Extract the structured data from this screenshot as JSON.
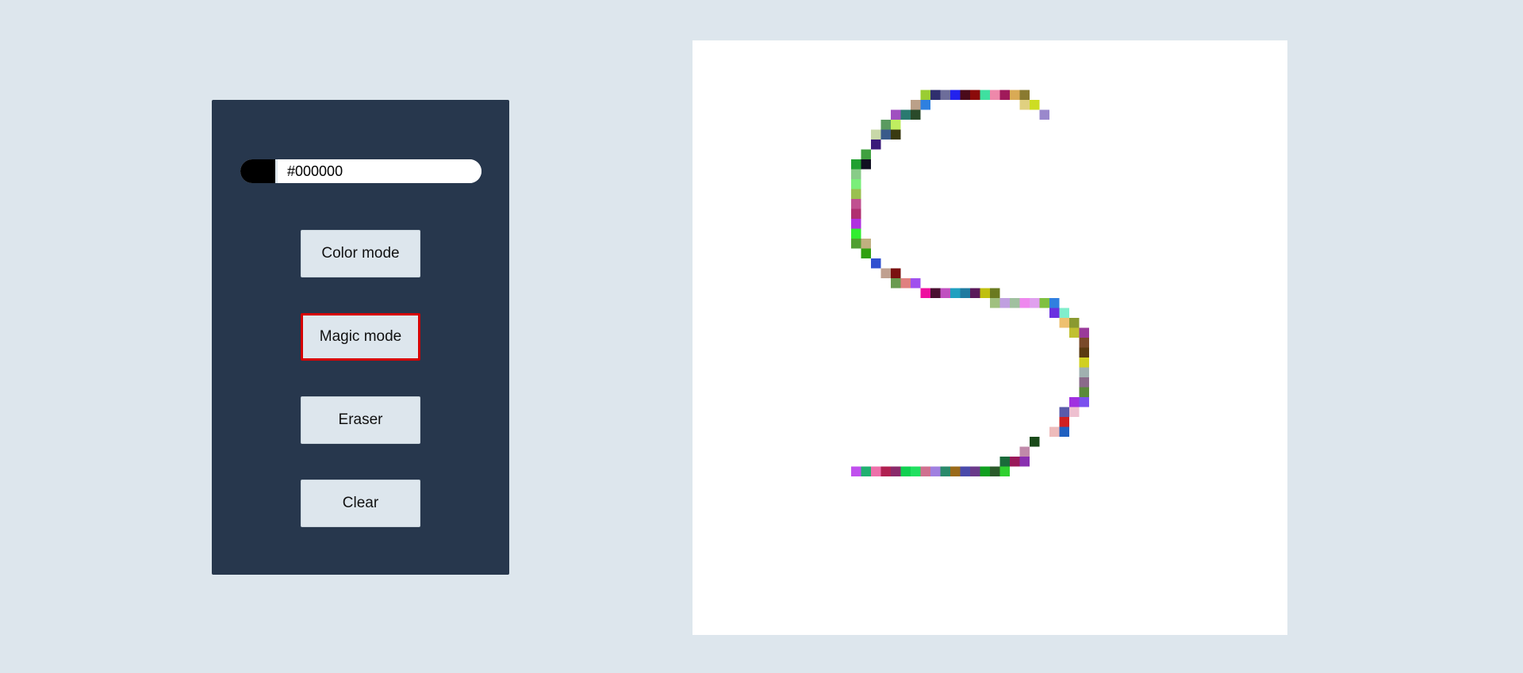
{
  "controls": {
    "swatch_color": "#000000",
    "hex_value": "#000000",
    "color_mode_label": "Color mode",
    "magic_mode_label": "Magic mode",
    "eraser_label": "Eraser",
    "clear_label": "Clear",
    "active_mode": "magic"
  },
  "colors": {
    "background": "#dde6ed",
    "panel": "#27374d",
    "active_border": "#d60000",
    "canvas": "#ffffff"
  },
  "canvas": {
    "cell_size_px": 12.5,
    "drawn_stroke": {
      "shape": "S",
      "cells": [
        [
          23,
          5,
          "#9acd32"
        ],
        [
          24,
          5,
          "#2f2f6e"
        ],
        [
          25,
          5,
          "#6d6d9a"
        ],
        [
          26,
          5,
          "#2222ee"
        ],
        [
          27,
          5,
          "#4a0a1a"
        ],
        [
          28,
          5,
          "#8b0a0a"
        ],
        [
          29,
          5,
          "#3fe0a0"
        ],
        [
          30,
          5,
          "#ee88aa"
        ],
        [
          31,
          5,
          "#a01a5a"
        ],
        [
          32,
          5,
          "#d9aa55"
        ],
        [
          33,
          5,
          "#8a7a30"
        ],
        [
          22,
          6,
          "#bba088"
        ],
        [
          23,
          6,
          "#2e80e0"
        ],
        [
          33,
          6,
          "#e0d080"
        ],
        [
          34,
          6,
          "#cddd22"
        ],
        [
          20,
          7,
          "#a050c0"
        ],
        [
          21,
          7,
          "#2a7a70"
        ],
        [
          22,
          7,
          "#2a4a2a"
        ],
        [
          35,
          7,
          "#9a88cc"
        ],
        [
          19,
          8,
          "#5a9a60"
        ],
        [
          20,
          8,
          "#c0ee60"
        ],
        [
          18,
          9,
          "#c8d8a8"
        ],
        [
          19,
          9,
          "#3a5a8a"
        ],
        [
          20,
          9,
          "#3a3a10"
        ],
        [
          18,
          10,
          "#3a1a7a"
        ],
        [
          17,
          11,
          "#40a040"
        ],
        [
          16,
          12,
          "#20a030"
        ],
        [
          17,
          12,
          "#101020"
        ],
        [
          16,
          13,
          "#88cc88"
        ],
        [
          16,
          14,
          "#7aee7a"
        ],
        [
          16,
          15,
          "#9ac050"
        ],
        [
          16,
          16,
          "#c05090"
        ],
        [
          16,
          17,
          "#b03070"
        ],
        [
          16,
          18,
          "#b030e0"
        ],
        [
          16,
          19,
          "#30ee30"
        ],
        [
          16,
          20,
          "#50a030"
        ],
        [
          17,
          20,
          "#c0b080"
        ],
        [
          17,
          21,
          "#30a010"
        ],
        [
          18,
          22,
          "#3050d0"
        ],
        [
          19,
          23,
          "#c0a090"
        ],
        [
          20,
          23,
          "#7a1010"
        ],
        [
          20,
          24,
          "#6a9a50"
        ],
        [
          21,
          24,
          "#e08080"
        ],
        [
          22,
          24,
          "#a050ee"
        ],
        [
          23,
          25,
          "#ee10a0"
        ],
        [
          24,
          25,
          "#4a1030"
        ],
        [
          25,
          25,
          "#c050c0"
        ],
        [
          26,
          25,
          "#20a0c0"
        ],
        [
          27,
          25,
          "#207aa0"
        ],
        [
          28,
          25,
          "#5a1a5a"
        ],
        [
          29,
          25,
          "#c0c010"
        ],
        [
          30,
          25,
          "#6a7a20"
        ],
        [
          30,
          26,
          "#a0c080"
        ],
        [
          31,
          26,
          "#c0a0e0"
        ],
        [
          32,
          26,
          "#a0c0a0"
        ],
        [
          33,
          26,
          "#ee88ee"
        ],
        [
          34,
          26,
          "#e0a0ee"
        ],
        [
          35,
          26,
          "#80c040"
        ],
        [
          36,
          26,
          "#3080e0"
        ],
        [
          36,
          27,
          "#6a30e0"
        ],
        [
          37,
          27,
          "#80eecc"
        ],
        [
          37,
          28,
          "#eec070"
        ],
        [
          38,
          28,
          "#8a9a30"
        ],
        [
          38,
          29,
          "#c0c030"
        ],
        [
          39,
          29,
          "#9a3a9a"
        ],
        [
          39,
          30,
          "#7a4a2a"
        ],
        [
          39,
          31,
          "#5a3a10"
        ],
        [
          39,
          32,
          "#d0d020"
        ],
        [
          39,
          33,
          "#a0b0b0"
        ],
        [
          39,
          34,
          "#8a6a8a"
        ],
        [
          39,
          35,
          "#5a8a3a"
        ],
        [
          38,
          36,
          "#a030e0"
        ],
        [
          39,
          36,
          "#7a50ee"
        ],
        [
          37,
          37,
          "#5a5aaa"
        ],
        [
          38,
          37,
          "#eec0d0"
        ],
        [
          37,
          38,
          "#d02020"
        ],
        [
          36,
          39,
          "#eebbbb"
        ],
        [
          37,
          39,
          "#2060c0"
        ],
        [
          34,
          40,
          "#1a4a1a"
        ],
        [
          33,
          41,
          "#c08aaa"
        ],
        [
          31,
          42,
          "#1a6a3a"
        ],
        [
          32,
          42,
          "#9a1a5a"
        ],
        [
          33,
          42,
          "#8a30b0"
        ],
        [
          16,
          43,
          "#c050ee"
        ],
        [
          17,
          43,
          "#20b070"
        ],
        [
          18,
          43,
          "#ee70aa"
        ],
        [
          19,
          43,
          "#b02050"
        ],
        [
          20,
          43,
          "#8a2a6a"
        ],
        [
          21,
          43,
          "#10d050"
        ],
        [
          22,
          43,
          "#20e060"
        ],
        [
          23,
          43,
          "#d07090"
        ],
        [
          24,
          43,
          "#a080e0"
        ],
        [
          25,
          43,
          "#2a8a6a"
        ],
        [
          26,
          43,
          "#9a6a1a"
        ],
        [
          27,
          43,
          "#4a4aaa"
        ],
        [
          28,
          43,
          "#6a3a8a"
        ],
        [
          29,
          43,
          "#10a020"
        ],
        [
          30,
          43,
          "#2a5a2a"
        ],
        [
          31,
          43,
          "#30d030"
        ]
      ]
    }
  }
}
